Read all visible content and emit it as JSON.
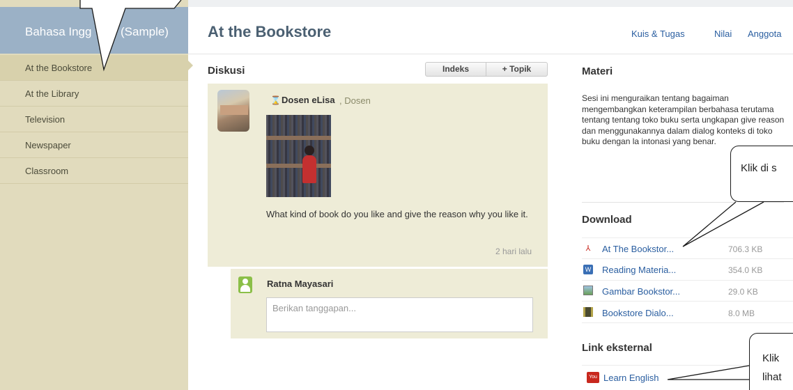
{
  "sidebar": {
    "course_title_pre": "Bahasa Ingg",
    "course_title_post": "(Sample)",
    "items": [
      {
        "label": "At the Bookstore",
        "active": true
      },
      {
        "label": "At the Library"
      },
      {
        "label": "Television"
      },
      {
        "label": "Newspaper"
      },
      {
        "label": "Classroom"
      }
    ]
  },
  "header": {
    "title": "At the Bookstore",
    "links": [
      "Kuis & Tugas",
      "Nilai",
      "Anggota"
    ]
  },
  "discussion": {
    "label": "Diskusi",
    "index_button": "Indeks",
    "topic_button": "+ Topik",
    "post": {
      "author": "Dosen eLisa",
      "role": ", Dosen",
      "text": "What kind of book do you like and give the reason why you like it.",
      "time": "2 hari lalu"
    },
    "reply": {
      "author": "Ratna Mayasari",
      "placeholder": "Berikan tanggapan..."
    }
  },
  "materi": {
    "heading": "Materi",
    "description": "Sesi ini menguraikan tentang bagaiman mengembangkan keterampilan berbahasa terutama tentang tentang toko buku serta ungkapan give reason dan menggunakannya dalam dialog konteks di toko buku dengan la intonasi yang benar."
  },
  "download": {
    "heading": "Download",
    "files": [
      {
        "name": "At The Bookstor...",
        "size": "706.3 KB",
        "icon": "pdf-icon"
      },
      {
        "name": "Reading Materia...",
        "size": "354.0 KB",
        "icon": "word-doc-icon"
      },
      {
        "name": "Gambar Bookstor...",
        "size": "29.0 KB",
        "icon": "image-file-icon"
      },
      {
        "name": "Bookstore Dialo...",
        "size": "8.0 MB",
        "icon": "video-file-icon"
      }
    ]
  },
  "links": {
    "heading": "Link eksternal",
    "items": [
      {
        "label": "Learn English",
        "icon": "youtube-icon"
      }
    ]
  },
  "callouts": {
    "download_text": "Klik di s",
    "link_text_1": "Klik",
    "link_text_2": "lihat"
  },
  "colors": {
    "sidebar_bg": "#e1dbbd",
    "sidebar_header": "#9bb1c6",
    "card_bg": "#eeecd7",
    "link": "#2a5ea0",
    "title": "#4b6072"
  }
}
